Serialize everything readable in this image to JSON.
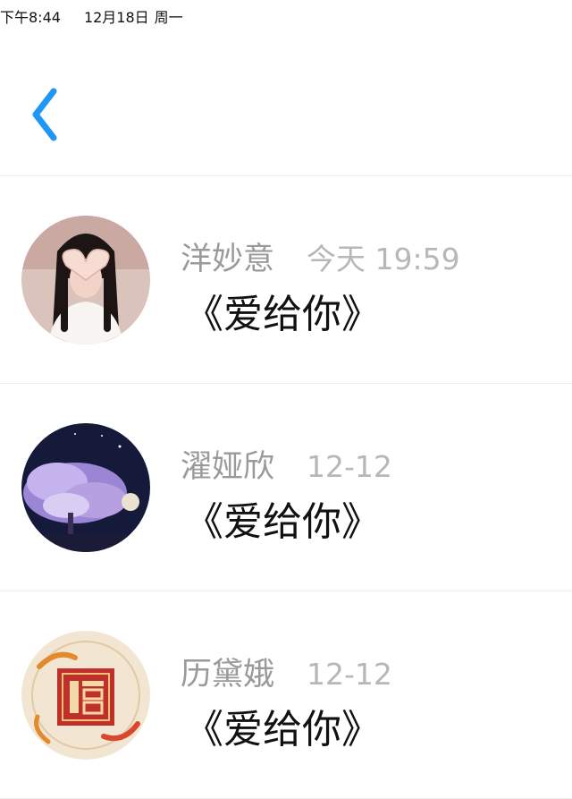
{
  "status_bar": {
    "time": "下午8:44",
    "date": "12月18日",
    "weekday": "周一"
  },
  "header": {
    "back_icon": "chevron-left-icon",
    "accent_color": "#2196f3"
  },
  "messages": [
    {
      "name": "洋妙意",
      "date": "今天 19:59",
      "message": "《爱给你》",
      "avatar": "photo-girl-heart-hands"
    },
    {
      "name": "濯娅欣",
      "date": "12-12",
      "message": "《爱给你》",
      "avatar": "purple-blossom-night"
    },
    {
      "name": "历黛娥",
      "date": "12-12",
      "message": "《爱给你》",
      "avatar": "fu-character-koi"
    }
  ]
}
